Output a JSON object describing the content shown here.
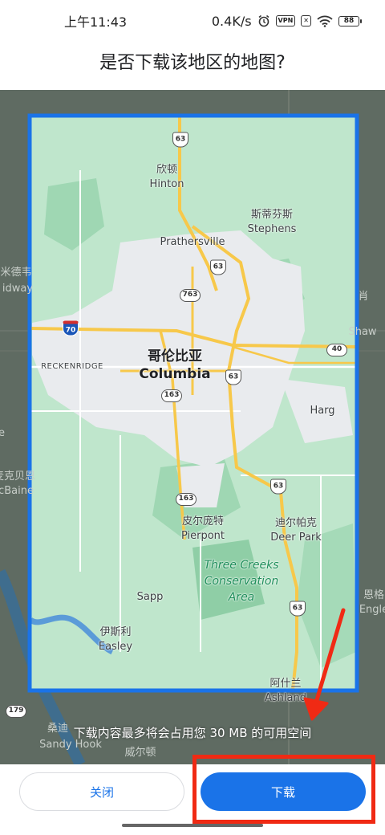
{
  "status_bar": {
    "time": "上午11:43",
    "net_speed": "0.4K/s",
    "vpn_label": "VPN",
    "battery": "88",
    "icons": [
      "alarm-icon",
      "vpn-icon",
      "no-sim-icon",
      "wifi-icon",
      "battery-icon"
    ]
  },
  "dialog": {
    "title": "是否下载该地区的地图?",
    "size_note": "下载内容最多将会占用您 30 MB 的可用空间",
    "close_label": "关闭",
    "download_label": "下载"
  },
  "map": {
    "places": {
      "hinton_zh": "欣顿",
      "hinton": "Hinton",
      "stephens_zh": "斯蒂芬斯",
      "stephens": "Stephens",
      "prathersville": "Prathersville",
      "columbia_zh": "哥伦比亚",
      "columbia": "Columbia",
      "harg": "Harg",
      "pierpont_zh": "皮尔庞特",
      "pierpont": "Pierpont",
      "deer_park_zh": "迪尔帕克",
      "deer_park": "Deer Park",
      "park_line1": "Three Creeks",
      "park_line2": "Conservation",
      "park_line3": "Area",
      "sapp": "Sapp",
      "easley_zh": "伊斯利",
      "easley": "Easley",
      "ashland_zh": "阿什兰",
      "ashland": "Ashland",
      "shaw_zh": "肖",
      "shaw": "Shaw",
      "brecken": "RECKENRIDGE",
      "midway_zh": "米德韦",
      "midway": "idway",
      "mcbaine_zh": "麦克贝恩",
      "mcbaine": "cBaine",
      "englewood_zh": "恩格",
      "englewood": "Engle",
      "sandy_hook_zh": "桑迪",
      "sandy_hook": "Sandy Hook",
      "wilton_zh": "威尔顿",
      "left_e": "e"
    },
    "shields": {
      "us63": "63",
      "mo763": "763",
      "mo163": "163",
      "i70": "70",
      "us40": "40",
      "r179": "179"
    },
    "colors": {
      "selection_border": "#1a73e8",
      "map_green": "#b7e2c6",
      "map_urban": "#e9ebee",
      "road_major": "#f7c84a",
      "water": "#5b9bd8"
    }
  }
}
